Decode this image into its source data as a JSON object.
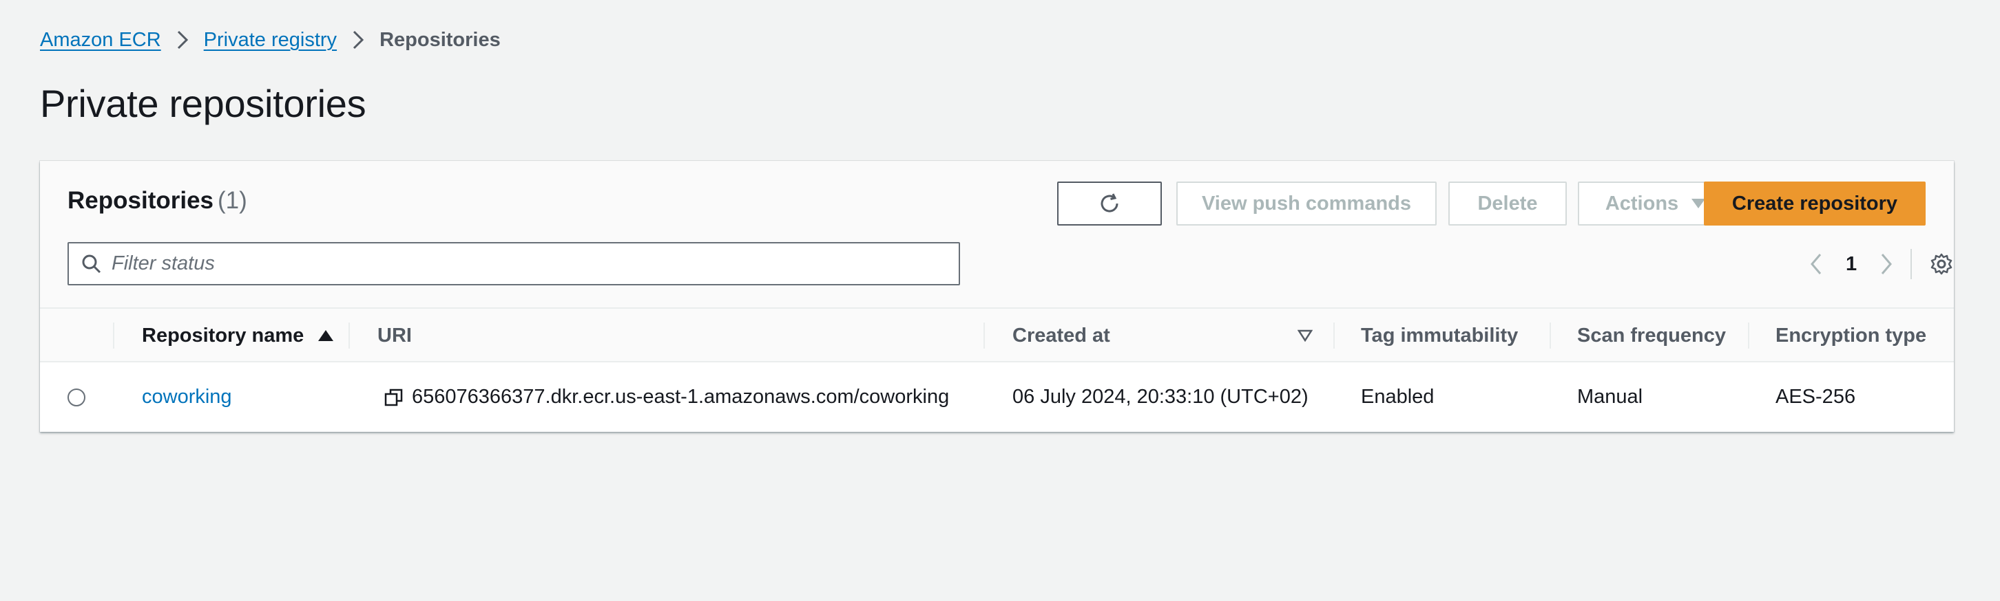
{
  "breadcrumb": {
    "items": [
      "Amazon ECR",
      "Private registry"
    ],
    "current": "Repositories"
  },
  "page": {
    "title": "Private repositories"
  },
  "container": {
    "title": "Repositories",
    "count": "(1)",
    "buttons": {
      "refresh_icon": "refresh-icon",
      "view_push": "View push commands",
      "delete": "Delete",
      "actions": "Actions",
      "create": "Create repository"
    },
    "filter": {
      "placeholder": "Filter status",
      "value": ""
    },
    "pagination": {
      "current_page": "1"
    }
  },
  "table": {
    "columns": [
      "Repository name",
      "URI",
      "Created at",
      "Tag immutability",
      "Scan frequency",
      "Encryption type"
    ],
    "rows": [
      {
        "name": "coworking",
        "uri": "656076366377.dkr.ecr.us-east-1.amazonaws.com/coworking",
        "created_at": "06 July 2024, 20:33:10 (UTC+02)",
        "tag_immutability": "Enabled",
        "scan_frequency": "Manual",
        "encryption_type": "AES-256"
      }
    ]
  },
  "colors": {
    "link": "#0073bb",
    "primary_button": "#ec972d",
    "background": "#f2f3f3"
  }
}
